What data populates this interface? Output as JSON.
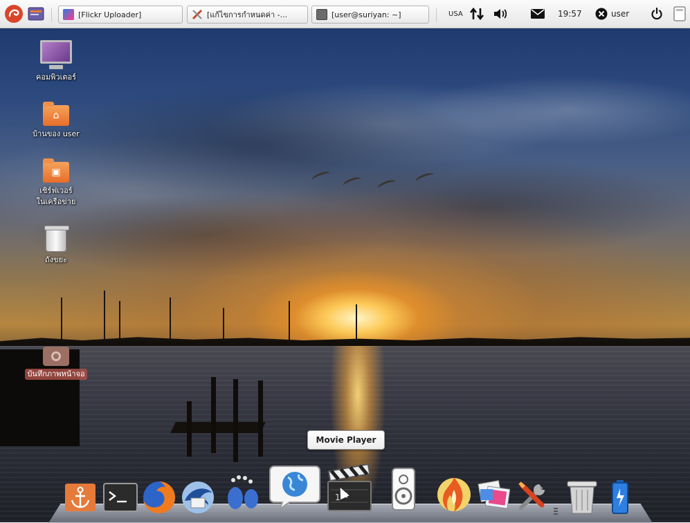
{
  "top_panel": {
    "tasks": [
      {
        "label": "[Flickr Uploader]"
      },
      {
        "label": "[แก้ไขการกำหนดค่า -..."
      },
      {
        "label": "[user@suriyan: ~]"
      }
    ],
    "keyboard_layout": "USA",
    "clock": "19:57",
    "user_name": "user"
  },
  "desktop_icons": [
    {
      "label": "คอมพิวเตอร์"
    },
    {
      "label": "บ้านของ user"
    },
    {
      "label": "เซิร์ฟเวอร์ในเครือข่าย"
    },
    {
      "label": "ถังขยะ"
    },
    {
      "label": "บันทึกภาพหน้าจอ"
    }
  ],
  "tooltip": {
    "label": "Movie Player"
  },
  "dock": {
    "items": [
      "anchor-icon",
      "terminal-icon",
      "firefox-icon",
      "thunderbird-icon",
      "gnome-foot-icon",
      "globe-chat-icon",
      "movie-player-icon",
      "speaker-icon",
      "flame-icon",
      "image-viewer-icon",
      "tools-icon",
      "trash-icon",
      "battery-icon"
    ]
  }
}
